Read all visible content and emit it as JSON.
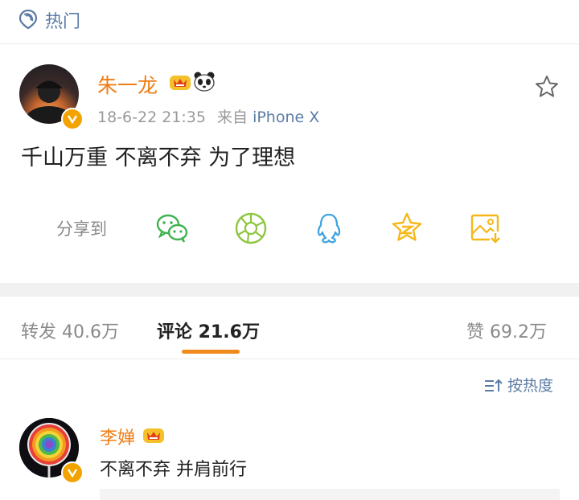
{
  "header": {
    "title": "热门"
  },
  "post": {
    "author": "朱一龙",
    "datetime": "18-6-22 21:35",
    "source_prefix": "来自",
    "source": "iPhone X",
    "text": "千山万重 不离不弃 为了理想",
    "share_label": "分享到",
    "share_targets": [
      "wechat-icon",
      "moments-icon",
      "qq-icon",
      "qzone-icon",
      "save-image-icon"
    ]
  },
  "tabs": {
    "repost": "转发 40.6万",
    "comment": "评论 21.6万",
    "like": "赞 69.2万"
  },
  "sort": {
    "label": "按热度"
  },
  "comment": {
    "author": "李婵",
    "text": "不离不弃 并肩前行"
  },
  "colors": {
    "accent": "#ef7d14",
    "link": "#5b7ca6",
    "badge": "#f3a300",
    "wechat": "#3fb34f",
    "moments": "#8dc63f",
    "qq": "#3fa4e0",
    "qzone": "#f5b81a"
  }
}
